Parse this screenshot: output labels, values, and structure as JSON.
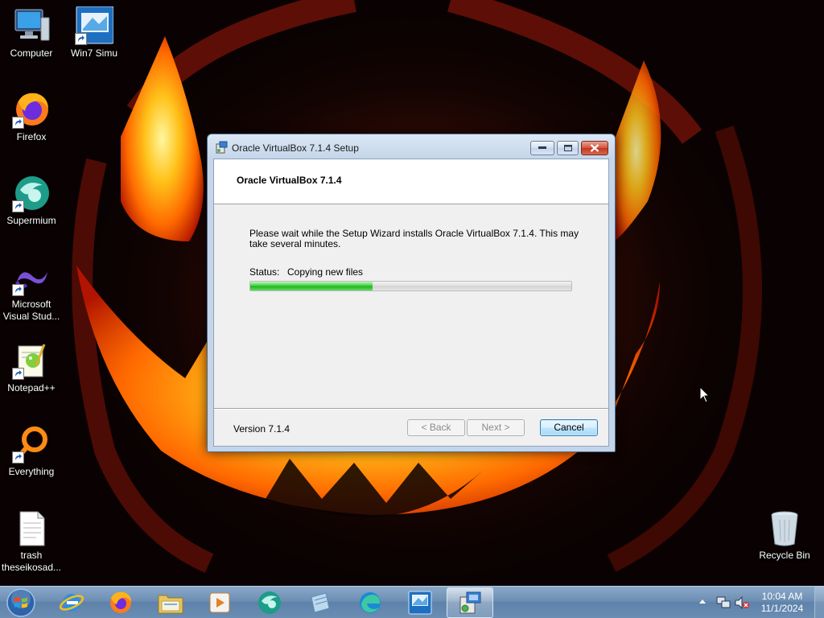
{
  "desktop": {
    "icons": [
      {
        "label": "Computer",
        "icon": "computer-icon"
      },
      {
        "label": "Win7 Simu",
        "icon": "win7-simu-icon"
      },
      {
        "label": "Firefox",
        "icon": "firefox-icon"
      },
      {
        "label": "Supermium",
        "icon": "supermium-icon"
      },
      {
        "label": "Microsoft\nVisual Stud...",
        "icon": "visual-studio-icon"
      },
      {
        "label": "Notepad++",
        "icon": "notepadpp-icon"
      },
      {
        "label": "Everything",
        "icon": "everything-icon"
      },
      {
        "label": "trash\ntheseikosad...",
        "icon": "text-file-icon"
      },
      {
        "label": "Recycle Bin",
        "icon": "recycle-bin-icon"
      }
    ]
  },
  "window": {
    "title": "Oracle VirtualBox 7.1.4 Setup",
    "header_title": "Oracle VirtualBox 7.1.4",
    "description": "Please wait while the Setup Wizard installs Oracle VirtualBox 7.1.4. This may take several minutes.",
    "status_label": "Status:",
    "status_value": "Copying new files",
    "progress": 0.38,
    "version": "Version 7.1.4",
    "buttons": {
      "back": "< Back",
      "next": "Next >",
      "cancel": "Cancel"
    }
  },
  "taskbar": {
    "items": [
      "start-orb",
      "ie-icon",
      "firefox-icon",
      "explorer-icon",
      "media-player-icon",
      "supermium-icon",
      "notepad-icon",
      "edge-icon",
      "win7-simu-icon",
      "installer-icon"
    ],
    "clock": {
      "time": "10:04 AM",
      "date": "11/1/2024"
    }
  },
  "colors": {
    "progress_green": "#1fb71f",
    "taskbar_blue": "#6d8fb4",
    "close_red": "#c3361d"
  }
}
